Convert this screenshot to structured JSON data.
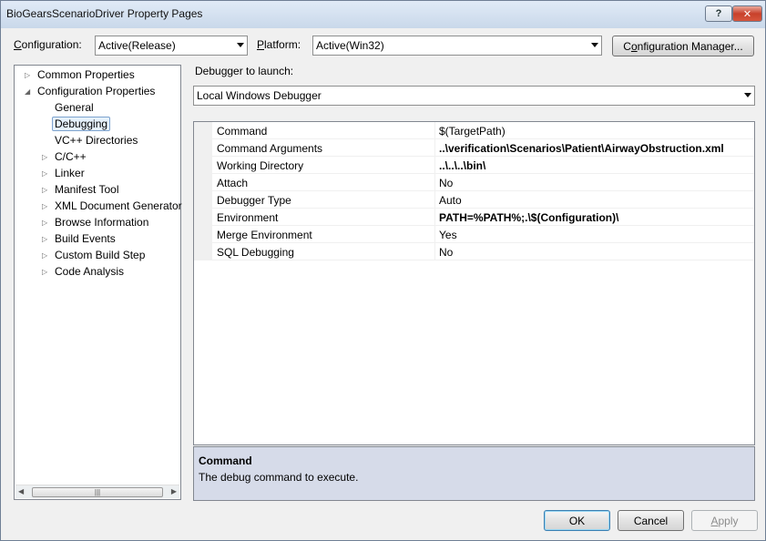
{
  "window": {
    "title": "BioGearsScenarioDriver Property Pages"
  },
  "toolbar": {
    "configuration_label_prefix": "",
    "configuration_label_key": "C",
    "configuration_label_rest": "onfiguration:",
    "configuration_value": "Active(Release)",
    "platform_label_key": "P",
    "platform_label_rest": "latform:",
    "platform_value": "Active(Win32)",
    "config_manager_prefix": "C",
    "config_manager_key": "o",
    "config_manager_rest": "nfiguration Manager..."
  },
  "tree": {
    "items": [
      {
        "label": "Common Properties",
        "expander": "collapsed"
      },
      {
        "label": "Configuration Properties",
        "expander": "expanded"
      },
      {
        "label": "General",
        "expander": "none"
      },
      {
        "label": "Debugging",
        "expander": "none",
        "selected": true
      },
      {
        "label": "VC++ Directories",
        "expander": "none"
      },
      {
        "label": "C/C++",
        "expander": "collapsed"
      },
      {
        "label": "Linker",
        "expander": "collapsed"
      },
      {
        "label": "Manifest Tool",
        "expander": "collapsed"
      },
      {
        "label": "XML Document Generator",
        "expander": "collapsed"
      },
      {
        "label": "Browse Information",
        "expander": "collapsed"
      },
      {
        "label": "Build Events",
        "expander": "collapsed"
      },
      {
        "label": "Custom Build Step",
        "expander": "collapsed"
      },
      {
        "label": "Code Analysis",
        "expander": "collapsed"
      }
    ]
  },
  "debugger": {
    "label": "Debugger to launch:",
    "value": "Local Windows Debugger"
  },
  "properties": [
    {
      "name": "Command",
      "value": "$(TargetPath)",
      "bold": false
    },
    {
      "name": "Command Arguments",
      "value": "..\\verification\\Scenarios\\Patient\\AirwayObstruction.xml",
      "bold": true
    },
    {
      "name": "Working Directory",
      "value": "..\\..\\..\\bin\\",
      "bold": true
    },
    {
      "name": "Attach",
      "value": "No",
      "bold": false
    },
    {
      "name": "Debugger Type",
      "value": "Auto",
      "bold": false
    },
    {
      "name": "Environment",
      "value": "PATH=%PATH%;.\\$(Configuration)\\",
      "bold": true
    },
    {
      "name": "Merge Environment",
      "value": "Yes",
      "bold": false
    },
    {
      "name": "SQL Debugging",
      "value": "No",
      "bold": false
    }
  ],
  "description": {
    "title": "Command",
    "text": "The debug command to execute."
  },
  "buttons": {
    "ok": "OK",
    "cancel": "Cancel",
    "apply_key": "A",
    "apply_rest": "pply"
  },
  "colors": {
    "selection_border": "#7da2ce",
    "description_bg": "#d6dbe9",
    "close_button": "#c8412b"
  }
}
